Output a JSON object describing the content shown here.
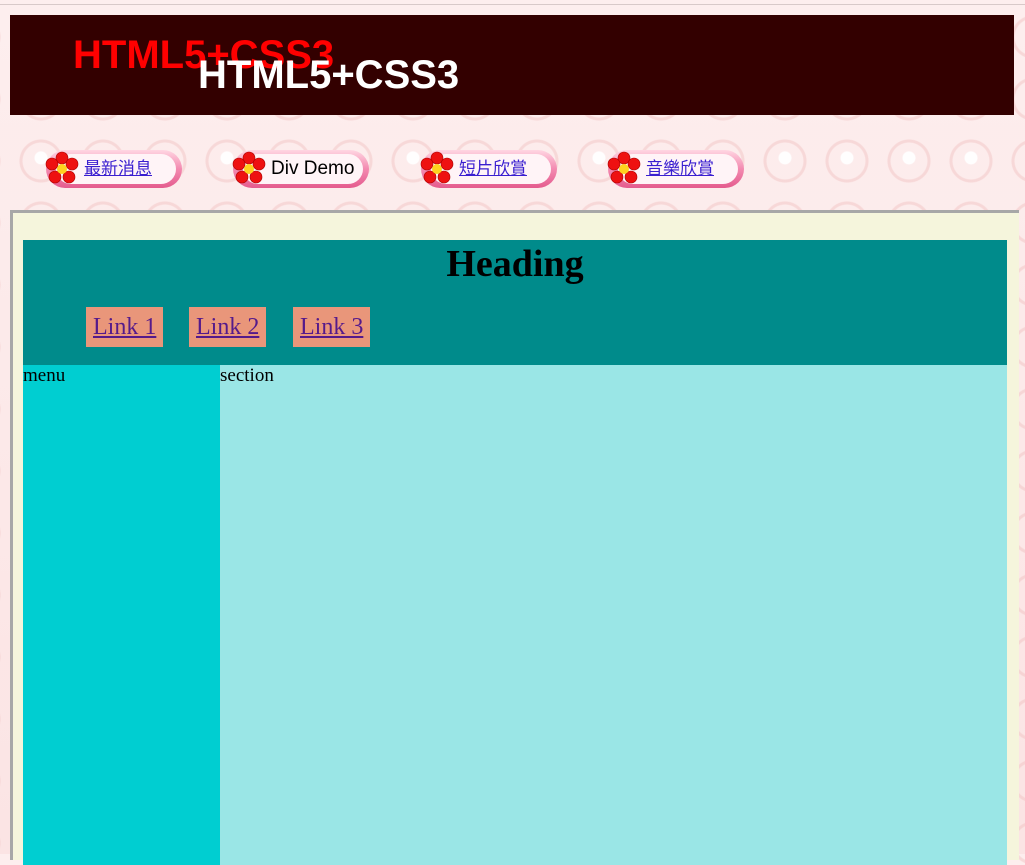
{
  "header": {
    "title_shadow": "HTML5+CSS3",
    "title_main": "HTML5+CSS3"
  },
  "nav": {
    "items": [
      {
        "label": "最新消息",
        "is_link": true
      },
      {
        "label": "Div Demo",
        "is_link": false
      },
      {
        "label": "短片欣賞",
        "is_link": true
      },
      {
        "label": "音樂欣賞",
        "is_link": true
      }
    ]
  },
  "main": {
    "heading": "Heading",
    "links": [
      "Link 1",
      "Link 2",
      "Link 3"
    ],
    "menu_text": "menu",
    "section_text": "section"
  },
  "colors": {
    "banner_bg": "#330000",
    "heading_bg": "#008b8b",
    "link_bg": "#e9967a",
    "menu_bg": "#00ced1",
    "section_bg": "#9ae6e6",
    "frame_bg": "#f5f5dc"
  },
  "icons": {
    "nav_bullet": "red-flower-icon"
  }
}
